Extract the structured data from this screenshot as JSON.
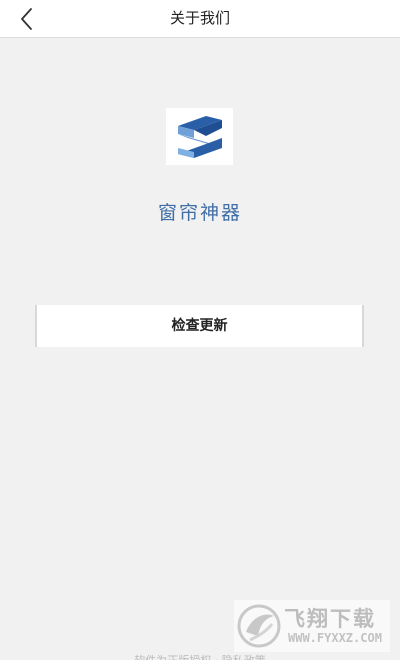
{
  "header": {
    "title": "关于我们",
    "back_icon": "chevron-left-icon"
  },
  "app": {
    "logo_icon": "s-logo-icon",
    "name": "窗帘神器",
    "name_color": "#3f6ea7"
  },
  "actions": {
    "check_update_label": "检查更新"
  },
  "watermark": {
    "text": "飞翔下载",
    "url": "WWW.FYXXZ.COM"
  },
  "footer": {
    "text": "软件为正版授权 · 隐私政策"
  }
}
